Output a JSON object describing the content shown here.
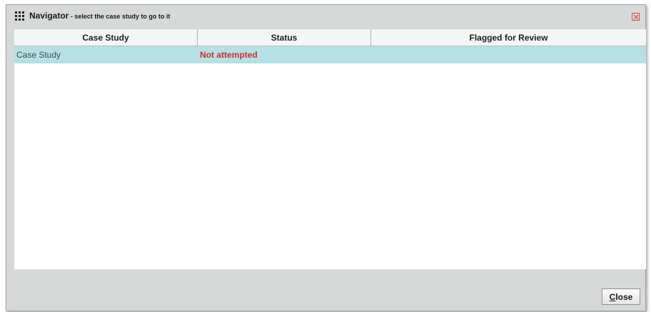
{
  "dialog": {
    "title": "Navigator",
    "subtitle": " - select the case study to go to it",
    "close_icon": "close-x-icon",
    "grid_icon": "grid-icon"
  },
  "table": {
    "columns": [
      "Case Study",
      "Status",
      "Flagged for Review"
    ],
    "rows": [
      {
        "case_study": "Case Study",
        "status": "Not attempted",
        "flagged": ""
      }
    ],
    "sorted_column": "Case Study",
    "sort_direction": "ascending",
    "selected_row_color": "#b6e0e3",
    "status_color": "#c9332e"
  },
  "footer": {
    "close_accesskey": "C",
    "close_rest": "lose"
  }
}
